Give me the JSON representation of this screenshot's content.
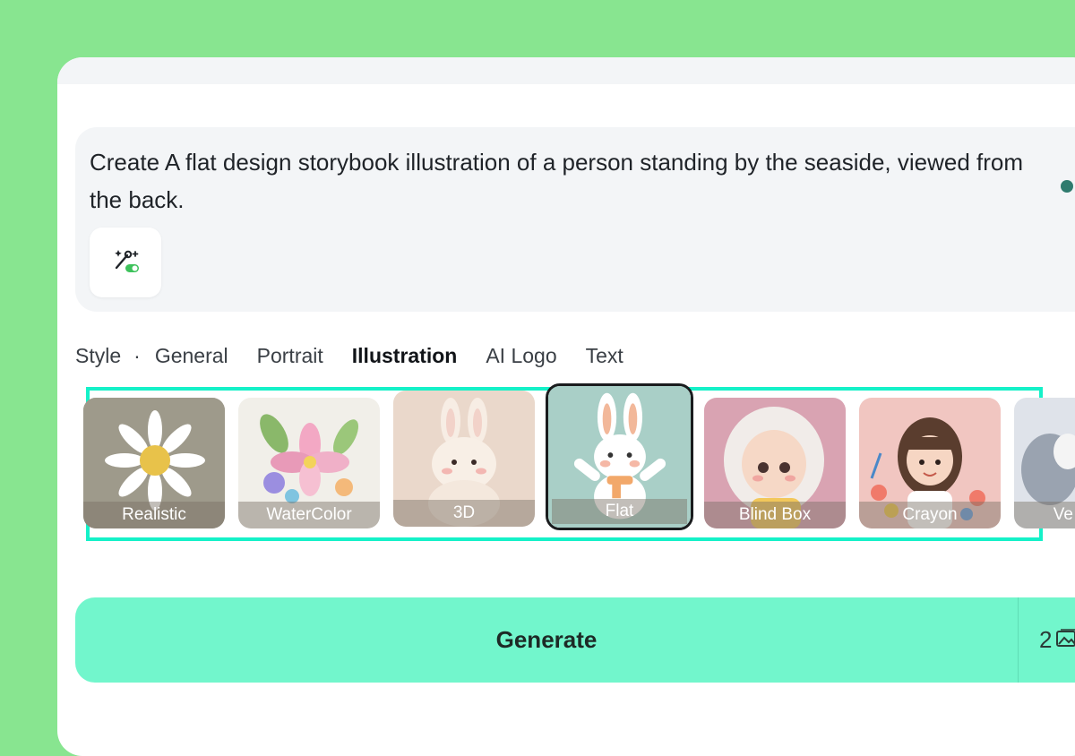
{
  "prompt": {
    "text": "Create A flat design storybook illustration of a person standing by the seaside, viewed from the back."
  },
  "style_bar": {
    "label": "Style",
    "separator": "·",
    "tabs": [
      {
        "label": "General"
      },
      {
        "label": "Portrait"
      },
      {
        "label": "Illustration",
        "active": true
      },
      {
        "label": "AI Logo"
      },
      {
        "label": "Text"
      }
    ]
  },
  "styles": [
    {
      "label": "Realistic",
      "image": "daisy"
    },
    {
      "label": "WaterColor",
      "image": "watercolor-flowers"
    },
    {
      "label": "3D",
      "image": "3d-bunny"
    },
    {
      "label": "Flat",
      "image": "flat-bunny",
      "selected": true
    },
    {
      "label": "Blind Box",
      "image": "blind-box-girl"
    },
    {
      "label": "Crayon",
      "image": "crayon-girl"
    },
    {
      "label": "Ve",
      "image": "vector-partial"
    }
  ],
  "generate": {
    "label": "Generate",
    "count": "2"
  },
  "colors": {
    "background": "#88e590",
    "accent": "#72f6cc",
    "highlight_frame": "#14f1c8"
  }
}
